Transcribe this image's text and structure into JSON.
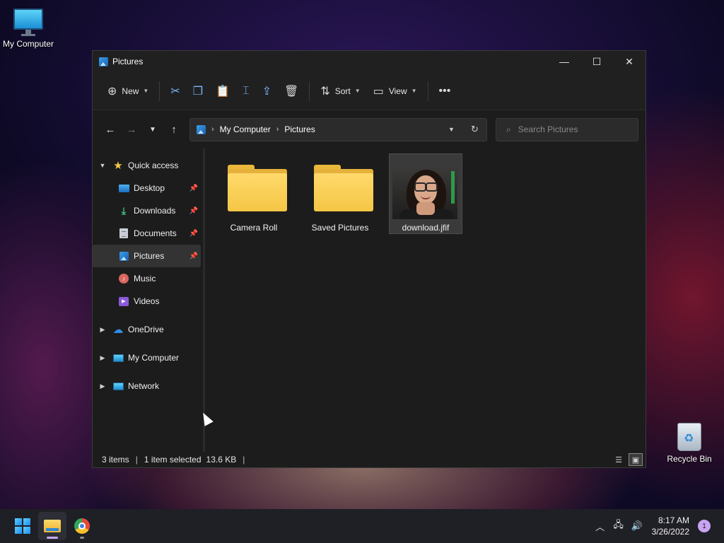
{
  "desktop": {
    "icons": [
      {
        "label": "My Computer",
        "icon": "monitor-icon"
      },
      {
        "label": "Recycle Bin",
        "icon": "recycle-bin-icon"
      }
    ]
  },
  "window": {
    "title": "Pictures",
    "controls": {
      "minimize": "—",
      "maximize": "☐",
      "close": "✕"
    }
  },
  "toolbar": {
    "new_label": "New",
    "sort_label": "Sort",
    "view_label": "View",
    "more_label": "•••",
    "icons": [
      "cut-icon",
      "copy-icon",
      "paste-icon",
      "rename-icon",
      "share-icon",
      "delete-icon"
    ]
  },
  "address": {
    "crumbs": [
      "My Computer",
      "Pictures"
    ],
    "search_placeholder": "Search Pictures"
  },
  "sidebar": {
    "quick_access": "Quick access",
    "items": [
      {
        "label": "Desktop",
        "pinned": true
      },
      {
        "label": "Downloads",
        "pinned": true
      },
      {
        "label": "Documents",
        "pinned": true
      },
      {
        "label": "Pictures",
        "pinned": true,
        "selected": true
      },
      {
        "label": "Music",
        "pinned": false
      },
      {
        "label": "Videos",
        "pinned": false
      }
    ],
    "roots": [
      "OneDrive",
      "My Computer",
      "Network"
    ]
  },
  "files": [
    {
      "name": "Camera Roll",
      "type": "folder"
    },
    {
      "name": "Saved Pictures",
      "type": "folder"
    },
    {
      "name": "download.jfif",
      "type": "image",
      "selected": true
    }
  ],
  "status": {
    "items": "3 items",
    "selected": "1 item selected",
    "size": "13.6 KB"
  },
  "taskbar": {
    "time": "8:17 AM",
    "date": "3/26/2022",
    "notifications": "1"
  },
  "colors": {
    "accent": "#c9a9f5",
    "folder": "#f5c645",
    "window_bg": "#1c1c1c"
  }
}
